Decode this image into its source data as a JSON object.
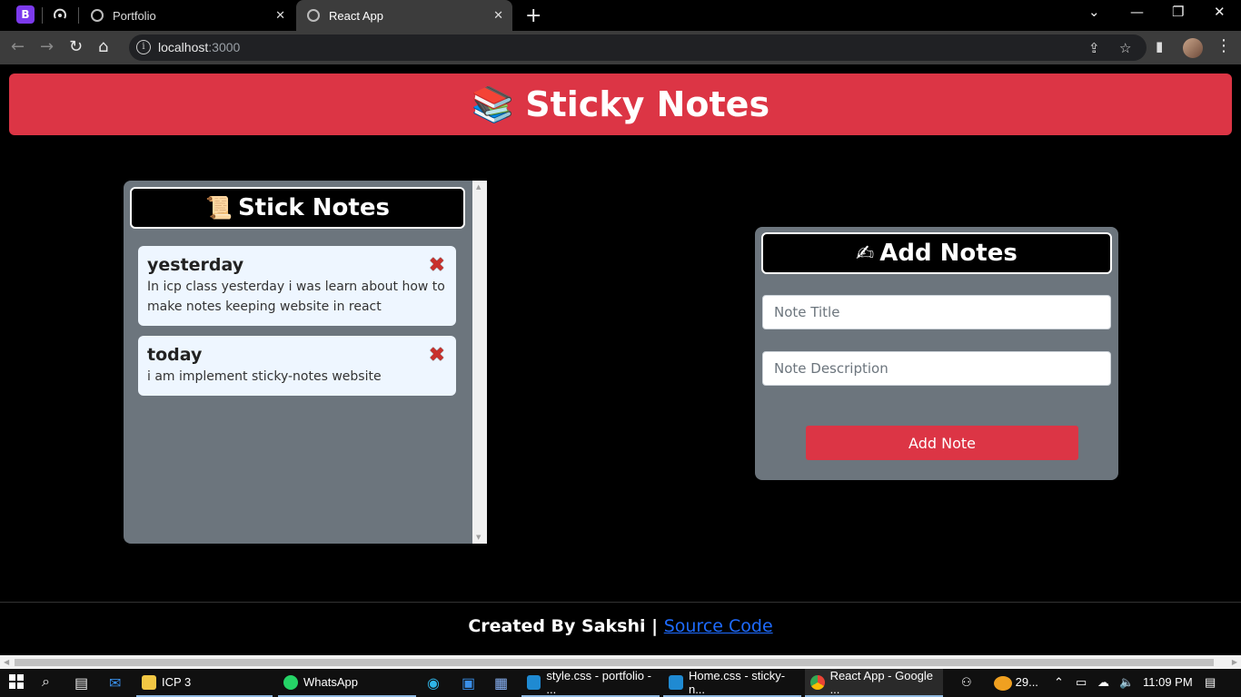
{
  "browser": {
    "tabs": [
      {
        "label": "Portfolio",
        "active": false
      },
      {
        "label": "React App",
        "active": true
      }
    ],
    "url_host": "localhost",
    "url_port": ":3000"
  },
  "header": {
    "title": "Sticky Notes",
    "emoji": "📚"
  },
  "notes_panel": {
    "title": "Stick Notes",
    "emoji": "📜",
    "notes": [
      {
        "title": "yesterday",
        "description": "In icp class yesterday i was learn about how to make notes keeping website in react"
      },
      {
        "title": "today",
        "description": "i am implement sticky-notes website"
      }
    ],
    "delete_glyph": "✖"
  },
  "add_panel": {
    "title": "Add Notes",
    "emoji": "✍",
    "title_placeholder": "Note Title",
    "description_placeholder": "Note Description",
    "button_label": "Add Note"
  },
  "footer": {
    "text": "Created By Sakshi |",
    "link": "Source Code"
  },
  "taskbar": {
    "apps": [
      {
        "label": "ICP 3"
      },
      {
        "label": "WhatsApp"
      },
      {
        "label": "style.css - portfolio - ..."
      },
      {
        "label": "Home.css - sticky-n..."
      },
      {
        "label": "React App - Google ..."
      }
    ],
    "weather": "29...",
    "time": "11:09 PM"
  },
  "colors": {
    "accent": "#dc3545",
    "panel": "#6c757d",
    "card": "#eef6ff",
    "link": "#1e6bff"
  }
}
